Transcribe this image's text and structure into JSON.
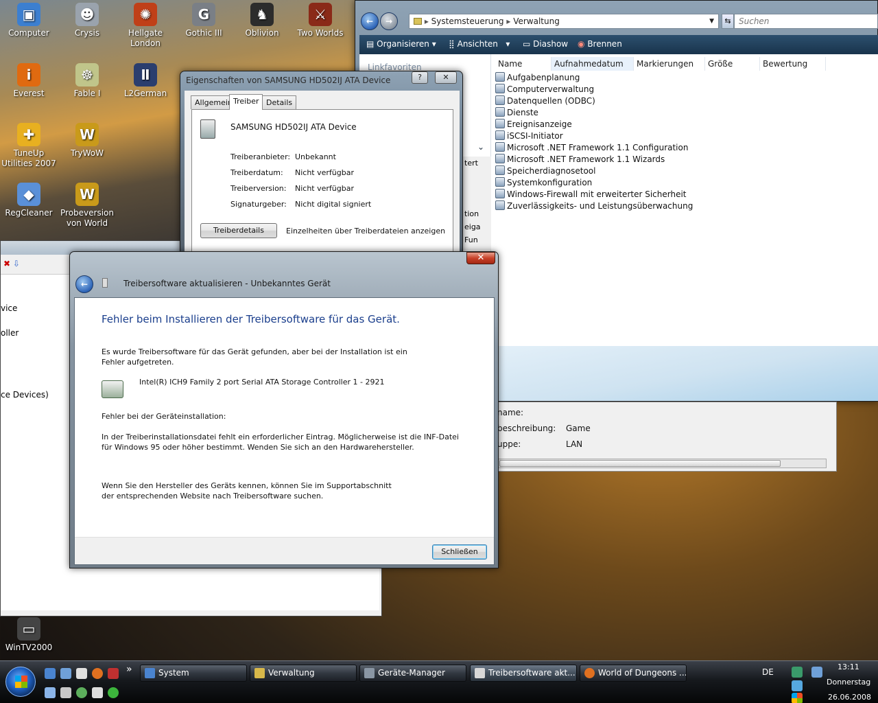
{
  "desktop": {
    "icons": [
      {
        "label": "Computer",
        "icon": "computer-icon",
        "color": "#3c7fd0"
      },
      {
        "label": "Crysis",
        "icon": "crysis-icon",
        "color": "#9aa3ad"
      },
      {
        "label": "Hellgate London",
        "icon": "hellgate-icon",
        "color": "#c04018"
      },
      {
        "label": "Gothic III",
        "icon": "gothic-icon",
        "color": "#7a7f86"
      },
      {
        "label": "Oblivion",
        "icon": "oblivion-icon",
        "color": "#2c2c2c"
      },
      {
        "label": "Two Worlds",
        "icon": "two-worlds-icon",
        "color": "#8a2a18"
      },
      {
        "label": "Everest",
        "icon": "everest-icon",
        "color": "#e06a10"
      },
      {
        "label": "Fable I",
        "icon": "fable-icon",
        "color": "#c0c58a"
      },
      {
        "label": "L2German",
        "icon": "l2german-icon",
        "color": "#2b3e6e"
      },
      {
        "label": "TuneUp Utilities 2007",
        "icon": "tuneup-icon",
        "color": "#e8b020"
      },
      {
        "label": "TryWoW",
        "icon": "wow-icon",
        "color": "#c99a1a"
      },
      {
        "label": "RegCleaner",
        "icon": "regcleaner-icon",
        "color": "#5a90d8"
      },
      {
        "label": "Probeversion von World",
        "icon": "wow-trial-icon",
        "color": "#c99a1a"
      },
      {
        "label": "WinTV2000",
        "icon": "wintv-icon",
        "color": "#444"
      }
    ]
  },
  "explorer": {
    "breadcrumb": [
      "Systemsteuerung",
      "Verwaltung"
    ],
    "search_placeholder": "Suchen",
    "toolbar": {
      "organize": "Organisieren",
      "views": "Ansichten",
      "slideshow": "Diashow",
      "burn": "Brennen"
    },
    "navpane": {
      "favorites": "Linkfavoriten"
    },
    "columns": [
      "Name",
      "Aufnahmedatum",
      "Markierungen",
      "Größe",
      "Bewertung"
    ],
    "files": [
      "Aufgabenplanung",
      "Computerverwaltung",
      "Datenquellen (ODBC)",
      "Dienste",
      "Ereignisanzeige",
      "iSCSI-Initiator",
      "Microsoft .NET Framework 1.1 Configuration",
      "Microsoft .NET Framework 1.1 Wizards",
      "Speicherdiagnosetool",
      "Systemkonfiguration",
      "Windows-Firewall mit erweiterter Sicherheit",
      "Zuverlässigkeits- und Leistungsüberwachung"
    ]
  },
  "props_panel": {
    "rows": [
      {
        "key": "name:",
        "value": ""
      },
      {
        "key": "beschreibung:",
        "value": "Game"
      },
      {
        "key": "uppe:",
        "value": "LAN"
      }
    ]
  },
  "samsung_dialog": {
    "title": "Eigenschaften von SAMSUNG HD502IJ ATA Device",
    "tabs": [
      "Allgemein",
      "Treiber",
      "Details"
    ],
    "device_name": "SAMSUNG HD502IJ ATA Device",
    "fields": [
      {
        "key": "Treiberanbieter:",
        "value": "Unbekannt"
      },
      {
        "key": "Treiberdatum:",
        "value": "Nicht verfügbar"
      },
      {
        "key": "Treiberversion:",
        "value": "Nicht verfügbar"
      },
      {
        "key": "Signaturgeber:",
        "value": "Nicht digital signiert"
      }
    ],
    "details_button": "Treiberdetails",
    "details_desc": "Einzelheiten über Treiberdateien anzeigen",
    "help_label": "?"
  },
  "devmgr": {
    "tree_fragments": [
      "vice",
      "oller",
      "ce Devices)"
    ],
    "side_fragments": [
      "tert",
      "tion",
      "eiga",
      "Fun"
    ]
  },
  "error_dialog": {
    "title": "Treibersoftware aktualisieren - Unbekanntes Gerät",
    "headline": "Fehler beim Installieren der Treibersoftware für das Gerät.",
    "intro": "Es wurde Treibersoftware für das Gerät gefunden, aber bei der Installation ist ein Fehler aufgetreten.",
    "device": "Intel(R) ICH9 Family 2 port Serial ATA Storage Controller 1 - 2921",
    "error_label": "Fehler bei der Geräteinstallation:",
    "error_text": "In der Treiberinstallationsdatei fehlt ein erforderlicher Eintrag. Möglicherweise ist die INF-Datei für Windows 95 oder höher bestimmt. Wenden Sie sich an den Hardwarehersteller.",
    "hint": "Wenn Sie den Hersteller des Geräts kennen, können Sie im Supportabschnitt der entsprechenden Website nach Treibersoftware suchen.",
    "close_button": "Schließen"
  },
  "taskbar": {
    "more": "»",
    "buttons": [
      {
        "label": "System",
        "color": "#4a84d0"
      },
      {
        "label": "Verwaltung",
        "color": "#d8b84a"
      },
      {
        "label": "Geräte-Manager",
        "color": "#8a96a4"
      },
      {
        "label": "Treibersoftware akt...",
        "color": "#d8d8d8"
      },
      {
        "label": "World of Dungeons ...",
        "color": "#e07020"
      }
    ],
    "lang": "DE",
    "time": "13:11",
    "day": "Donnerstag",
    "date": "26.06.2008"
  }
}
